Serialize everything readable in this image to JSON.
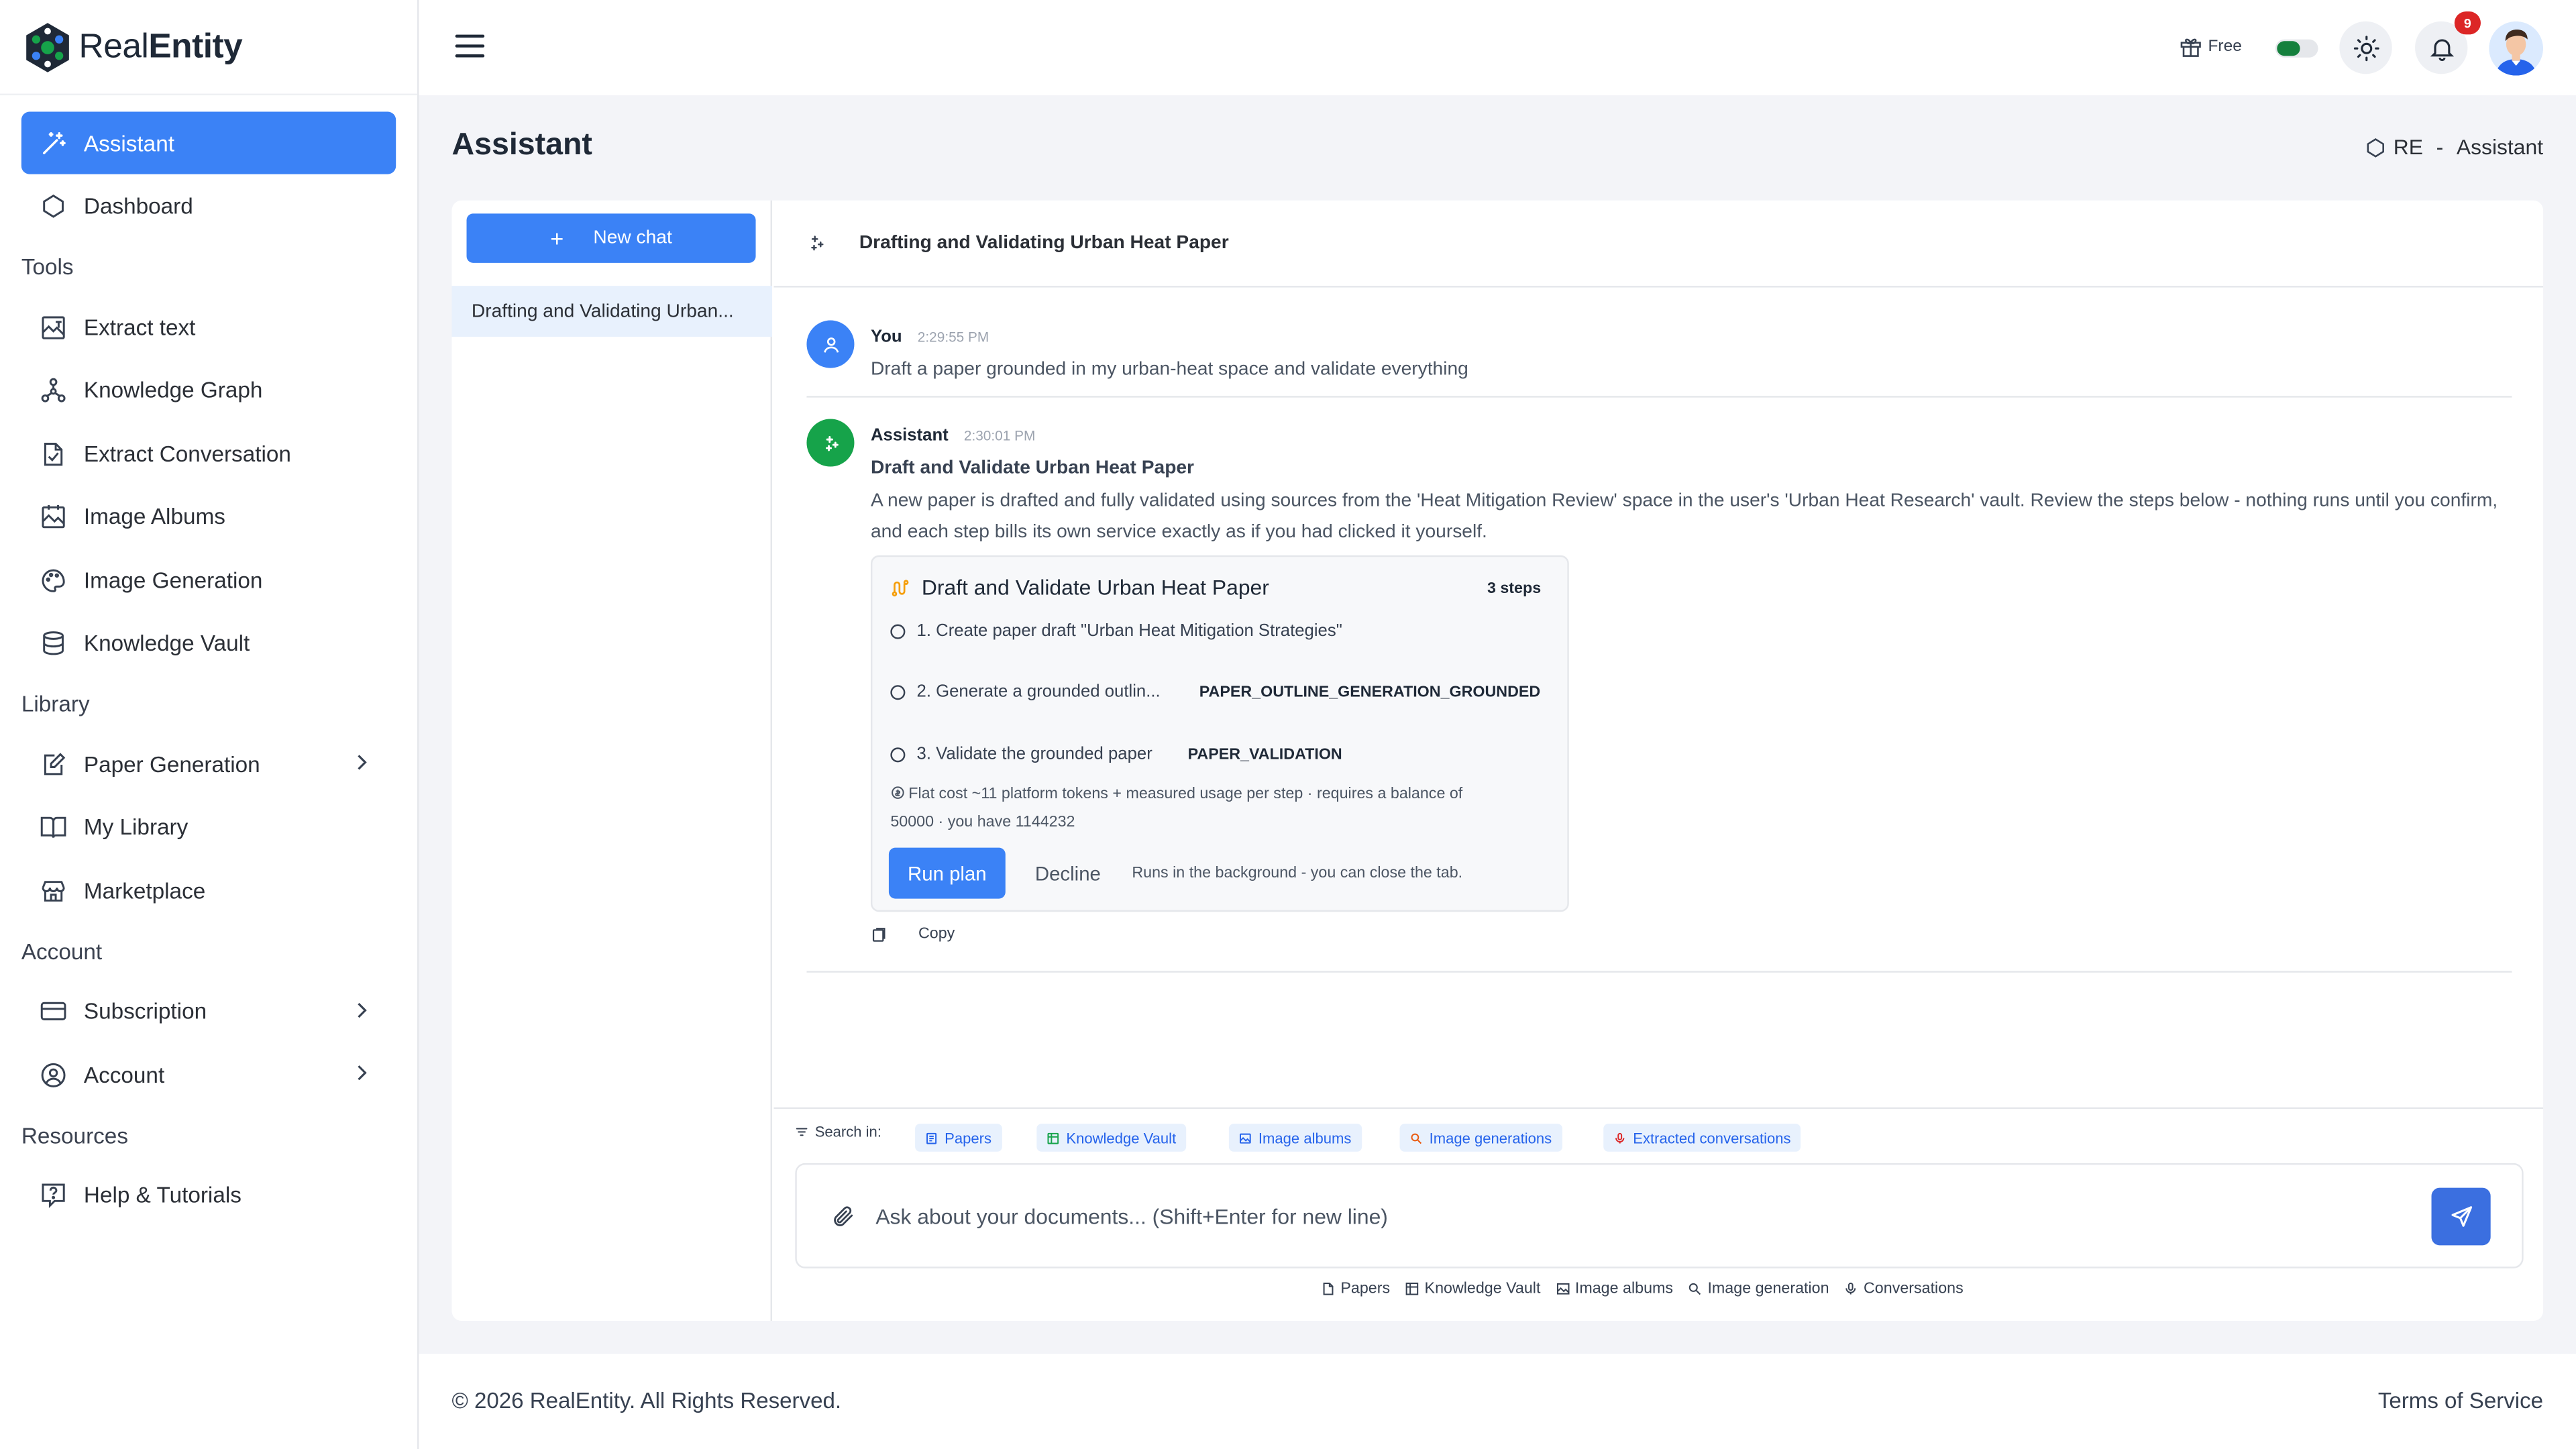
{
  "app": {
    "logo_text_light": "Real",
    "logo_text_bold": "Entity"
  },
  "sidebar": {
    "items_top": [
      {
        "label": "Assistant",
        "icon": "magic-wand-icon",
        "active": true
      },
      {
        "label": "Dashboard",
        "icon": "dashboard-icon",
        "active": false
      }
    ],
    "sections": {
      "tools": "Tools",
      "library": "Library",
      "account": "Account",
      "resources": "Resources"
    },
    "tools": [
      {
        "label": "Extract text",
        "icon": "extract-text-icon"
      },
      {
        "label": "Knowledge Graph",
        "icon": "graph-icon"
      },
      {
        "label": "Extract Conversation",
        "icon": "extract-conversation-icon"
      },
      {
        "label": "Image Albums",
        "icon": "image-album-icon"
      },
      {
        "label": "Image Generation",
        "icon": "palette-icon"
      },
      {
        "label": "Knowledge Vault",
        "icon": "database-icon"
      }
    ],
    "library": [
      {
        "label": "Paper Generation",
        "icon": "edit-icon",
        "has_chevron": true
      },
      {
        "label": "My Library",
        "icon": "book-icon"
      },
      {
        "label": "Marketplace",
        "icon": "store-icon"
      }
    ],
    "account": [
      {
        "label": "Subscription",
        "icon": "credit-card-icon",
        "has_chevron": true
      },
      {
        "label": "Account",
        "icon": "user-circle-icon",
        "has_chevron": true
      }
    ],
    "resources": [
      {
        "label": "Help & Tutorials",
        "icon": "help-icon"
      }
    ]
  },
  "topbar": {
    "plan_label": "Free",
    "notification_count": "9",
    "theme_toggle_on": true
  },
  "header": {
    "title": "Assistant",
    "breadcrumb_root": "RE",
    "breadcrumb_sep": "-",
    "breadcrumb_current": "Assistant"
  },
  "chatlist": {
    "new_chat_label": "New chat",
    "new_chat_plus": "+",
    "entries": [
      "Drafting and Validating Urban..."
    ]
  },
  "conversation": {
    "title": "Drafting and Validating Urban Heat Paper",
    "user_msg": {
      "name": "You",
      "time": "2:29:55 PM",
      "text": "Draft a paper grounded in my urban-heat space and validate everything"
    },
    "assistant_msg": {
      "name": "Assistant",
      "time": "2:30:01 PM",
      "title": "Draft and Validate Urban Heat Paper",
      "text": "A new paper is drafted and fully validated using sources from the 'Heat Mitigation Review' space in the user's 'Urban Heat Research' vault. Review the steps below - nothing runs until you confirm, and each step bills its own service exactly as if you had clicked it yourself."
    },
    "plan": {
      "title": "Draft and Validate Urban Heat Paper",
      "steps_count": "3 steps",
      "steps": [
        {
          "text": "1. Create paper draft \"Urban Heat Mitigation Strategies\"",
          "code": ""
        },
        {
          "text": "2. Generate a grounded outlin...",
          "code": "PAPER_OUTLINE_GENERATION_GROUNDED"
        },
        {
          "text": "3. Validate the grounded paper",
          "code": "PAPER_VALIDATION"
        }
      ],
      "cost_line1": "Flat cost ~11 platform tokens + measured usage per step · requires a balance of",
      "cost_line2": "50000 · you have 1144232",
      "run_label": "Run plan",
      "decline_label": "Decline",
      "background_note": "Runs in the background - you can close the tab."
    },
    "copy_label": "Copy"
  },
  "composer": {
    "search_in_label": "Search in:",
    "chips": [
      {
        "label": "Papers",
        "color": "#2563eb"
      },
      {
        "label": "Knowledge Vault",
        "color": "#16a34a"
      },
      {
        "label": "Image albums",
        "color": "#2563eb"
      },
      {
        "label": "Image generations",
        "color": "#ea580c"
      },
      {
        "label": "Extracted conversations",
        "color": "#dc2626"
      }
    ],
    "placeholder": "Ask about your documents... (Shift+Enter for new line)",
    "sources": [
      "Papers",
      "Knowledge Vault",
      "Image albums",
      "Image generation",
      "Conversations"
    ]
  },
  "footer": {
    "copyright": "© 2026 RealEntity. All Rights Reserved.",
    "terms": "Terms of Service"
  },
  "colors": {
    "primary": "#3b82f6",
    "assistant_avatar": "#16a34a",
    "badge": "#dc2626"
  }
}
